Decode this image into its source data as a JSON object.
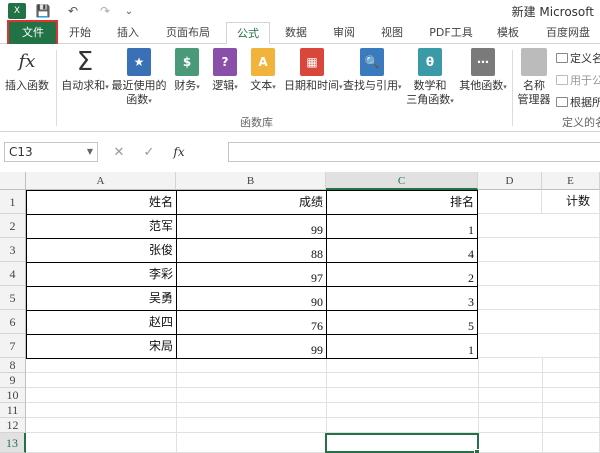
{
  "window": {
    "title": "新建 Microsoft",
    "quick_access": [
      "save-icon",
      "undo-icon",
      "redo-icon",
      "customize-icon"
    ],
    "save_glyph": "💾",
    "undo_glyph": "↶",
    "redo_glyph": "↷",
    "customize_glyph": "⌄"
  },
  "tabs": [
    {
      "label": "文件"
    },
    {
      "label": "开始"
    },
    {
      "label": "插入"
    },
    {
      "label": "页面布局"
    },
    {
      "label": "公式"
    },
    {
      "label": "数据"
    },
    {
      "label": "审阅"
    },
    {
      "label": "视图"
    },
    {
      "label": "PDF工具"
    },
    {
      "label": "模板"
    },
    {
      "label": "百度网盘"
    }
  ],
  "ribbon": {
    "insert_function": {
      "icon": "fx",
      "label": "插入函数"
    },
    "autosum": {
      "icon": "Σ",
      "label": "自动求和"
    },
    "recent": {
      "icon": "★",
      "label1": "最近使用的",
      "label2": "函数"
    },
    "finance": {
      "icon": "$",
      "label": "财务"
    },
    "logical": {
      "icon": "?",
      "label": "逻辑"
    },
    "text": {
      "icon": "A",
      "label": "文本"
    },
    "datetime": {
      "icon": "▦",
      "label": "日期和时间"
    },
    "lookup": {
      "icon": "🔍",
      "label": "查找与引用"
    },
    "math": {
      "icon": "θ",
      "label1": "数学和",
      "label2": "三角函数"
    },
    "more": {
      "icon": "⋯",
      "label": "其他函数"
    },
    "group_library": "函数库",
    "name_manager": {
      "label1": "名称",
      "label2": "管理器"
    },
    "define_name": "定义名",
    "use_in_formula": "用于公",
    "create_from_sel": "根据所",
    "group_defined": "定义的名",
    "caret": "▾"
  },
  "formula_bar": {
    "name_box": "C13",
    "dropdown": "▼",
    "cancel": "✕",
    "enter": "✓",
    "fx": "fx",
    "value": ""
  },
  "grid": {
    "columns": [
      "A",
      "B",
      "C",
      "D",
      "E"
    ],
    "selected_column": "C",
    "rows": [
      "1",
      "2",
      "3",
      "4",
      "5",
      "6",
      "7",
      "8",
      "9",
      "10",
      "11",
      "12",
      "13"
    ],
    "selected_row": "13",
    "header": [
      "姓名",
      "成绩",
      "排名"
    ],
    "e1": "计数",
    "data": [
      [
        "范军",
        "99",
        "1"
      ],
      [
        "张俊",
        "88",
        "4"
      ],
      [
        "李彩",
        "97",
        "2"
      ],
      [
        "吴勇",
        "90",
        "3"
      ],
      [
        "赵四",
        "76",
        "5"
      ],
      [
        "宋局",
        "99",
        "1"
      ]
    ],
    "colors": {
      "accent": "#217346",
      "highlight_outline": "#e0322f"
    }
  }
}
